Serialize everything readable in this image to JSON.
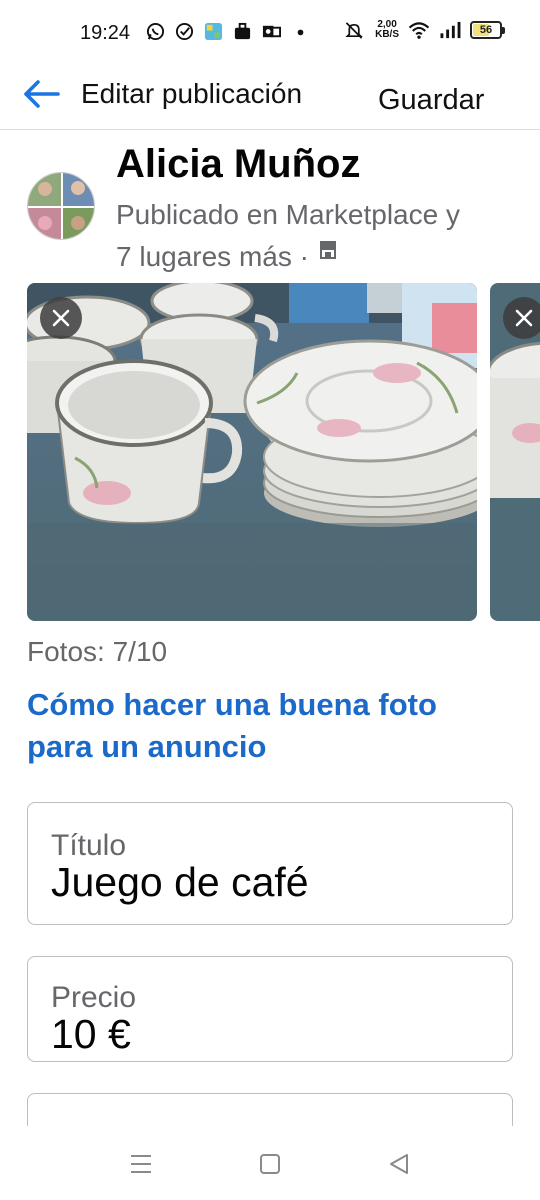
{
  "status_bar": {
    "time": "19:24",
    "net_speed_value": "2,00",
    "net_speed_unit": "KB/S",
    "battery": "56",
    "battery_level": 0.56,
    "left_icons": [
      "whatsapp-icon",
      "check-circle-icon",
      "hola-app-icon",
      "briefcase-icon",
      "outlook-icon",
      "dot-icon"
    ],
    "right_icons": [
      "mute-icon",
      "wifi-icon",
      "signal-icon",
      "battery-icon"
    ]
  },
  "header": {
    "title": "Editar publicación",
    "save_label": "Guardar",
    "accent_color": "#1b74e4"
  },
  "profile": {
    "name": "Alicia Muñoz",
    "subtitle_line1": "Publicado en Marketplace y",
    "subtitle_line2": "7 lugares más ·"
  },
  "photos": {
    "count_text": "Fotos: 7/10",
    "tip_link": "Cómo hacer una buena foto para un anuncio"
  },
  "fields": {
    "title_label": "Título",
    "title_value": "Juego de café",
    "price_label": "Precio",
    "price_value": "10 €"
  },
  "nav": {
    "items": [
      "menu-icon",
      "home-icon",
      "back-icon"
    ]
  }
}
